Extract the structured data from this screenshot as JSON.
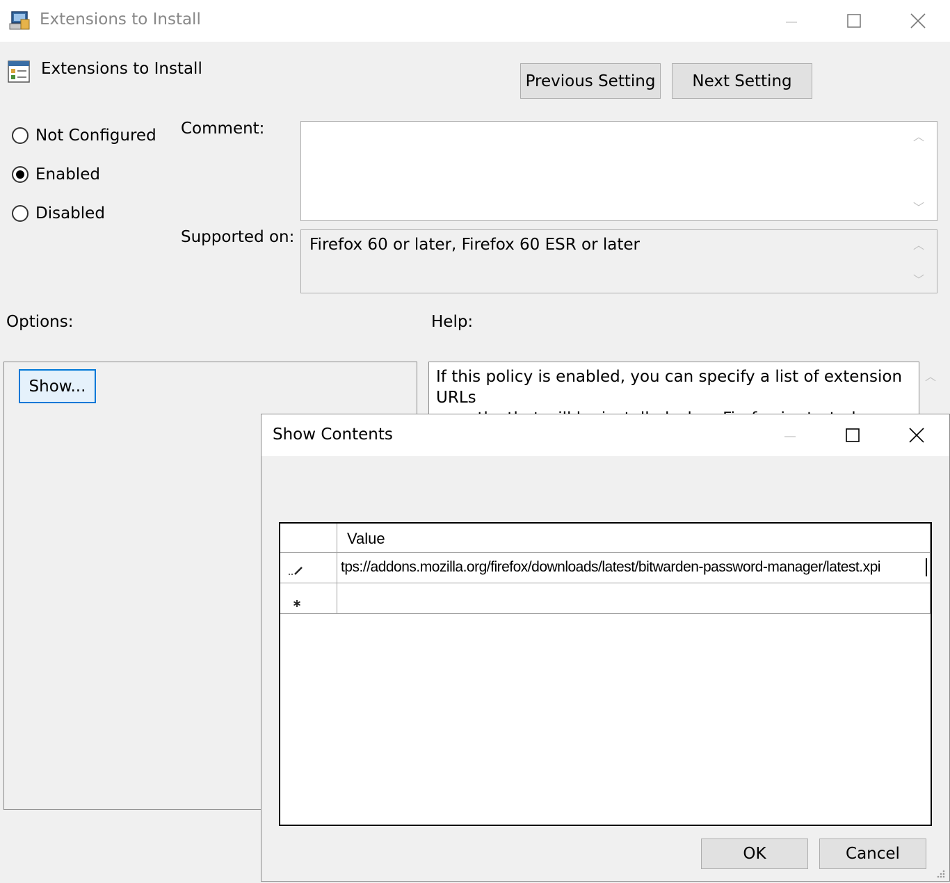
{
  "window": {
    "title": "Extensions to Install",
    "setting_name": "Extensions to Install",
    "prev_button": "Previous Setting",
    "next_button": "Next Setting"
  },
  "state": {
    "options": [
      "Not Configured",
      "Enabled",
      "Disabled"
    ],
    "selected": "Enabled"
  },
  "labels": {
    "comment": "Comment:",
    "supported_on": "Supported on:",
    "options": "Options:",
    "help": "Help:"
  },
  "supported_on_value": "Firefox 60 or later, Firefox 60 ESR or later",
  "show_button": "Show...",
  "help_lines": [
    "If this policy is enabled, you can specify a list of extension URLs",
    "or paths that will be installed when Firefox is started."
  ],
  "dialog": {
    "title": "Show Contents",
    "column_header": "Value",
    "row_value": "tps://addons.mozilla.org/firefox/downloads/latest/bitwarden-password-manager/latest.xpi",
    "ok": "OK",
    "cancel": "Cancel"
  },
  "icons": {
    "app": "policy-computer-icon",
    "setting": "policy-setting-icon",
    "edit_row": "pencil-icon",
    "new_row": "asterisk-icon"
  }
}
